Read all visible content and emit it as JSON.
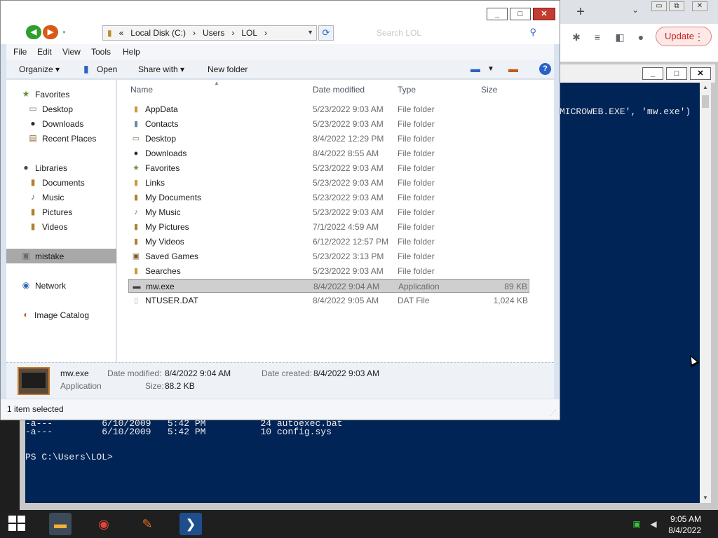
{
  "chrome": {
    "new_tab_glyph": "+",
    "tab_search_glyph": "⌄",
    "win_min": "▭",
    "win_restore": "⧉",
    "win_close": "✕",
    "update_label": "Update",
    "menu_glyph": "⋮",
    "icons": [
      "puzzle-icon",
      "media-icon",
      "sidepanel-icon",
      "profile-icon"
    ]
  },
  "powershell": {
    "win_min": "_",
    "win_max": "□",
    "win_close": "✕",
    "lines": [
      "MICROWEB.EXE', 'mw.exe')",
      "-a---         6/10/2009   5:42 PM          24 autoexec.bat",
      "-a---         6/10/2009   5:42 PM          10 config.sys",
      "PS C:\\Users\\LOL>"
    ]
  },
  "explorer": {
    "win_min": "_",
    "win_max": "□",
    "win_close": "✕",
    "nav_back": "◀",
    "nav_forward": "▶",
    "address": [
      "«",
      "Local Disk (C:)",
      "›",
      "Users",
      "›",
      "LOL",
      "›"
    ],
    "search_placeholder": "Search LOL",
    "menu": [
      "File",
      "Edit",
      "View",
      "Tools",
      "Help"
    ],
    "commands": {
      "organize": "Organize ▾",
      "open": "Open",
      "share": "Share with ▾",
      "new_folder": "New folder"
    },
    "nav": {
      "favorites": "Favorites",
      "desktop": "Desktop",
      "downloads": "Downloads",
      "recent": "Recent Places",
      "libraries": "Libraries",
      "documents": "Documents",
      "music": "Music",
      "pictures": "Pictures",
      "videos": "Videos",
      "user": "mistake",
      "network": "Network",
      "catalog": "Image Catalog"
    },
    "columns": {
      "name": "Name",
      "date": "Date modified",
      "type": "Type",
      "size": "Size"
    },
    "files": [
      {
        "name": "AppData",
        "date": "5/23/2022 9:03 AM",
        "type": "File folder",
        "size": ""
      },
      {
        "name": "Contacts",
        "date": "5/23/2022 9:03 AM",
        "type": "File folder",
        "size": ""
      },
      {
        "name": "Desktop",
        "date": "8/4/2022 12:29 PM",
        "type": "File folder",
        "size": ""
      },
      {
        "name": "Downloads",
        "date": "8/4/2022 8:55 AM",
        "type": "File folder",
        "size": ""
      },
      {
        "name": "Favorites",
        "date": "5/23/2022 9:03 AM",
        "type": "File folder",
        "size": ""
      },
      {
        "name": "Links",
        "date": "5/23/2022 9:03 AM",
        "type": "File folder",
        "size": ""
      },
      {
        "name": "My Documents",
        "date": "5/23/2022 9:03 AM",
        "type": "File folder",
        "size": ""
      },
      {
        "name": "My Music",
        "date": "5/23/2022 9:03 AM",
        "type": "File folder",
        "size": ""
      },
      {
        "name": "My Pictures",
        "date": "7/1/2022 4:59 AM",
        "type": "File folder",
        "size": ""
      },
      {
        "name": "My Videos",
        "date": "6/12/2022 12:57 PM",
        "type": "File folder",
        "size": ""
      },
      {
        "name": "Saved Games",
        "date": "5/23/2022 3:13 PM",
        "type": "File folder",
        "size": ""
      },
      {
        "name": "Searches",
        "date": "5/23/2022 9:03 AM",
        "type": "File folder",
        "size": ""
      },
      {
        "name": "mw.exe",
        "date": "8/4/2022 9:04 AM",
        "type": "Application",
        "size": "89 KB"
      },
      {
        "name": "NTUSER.DAT",
        "date": "8/4/2022 9:05 AM",
        "type": "DAT File",
        "size": "1,024 KB"
      }
    ],
    "details": {
      "name": "mw.exe",
      "kind": "Application",
      "modified_label": "Date modified:",
      "modified_value": "8/4/2022 9:04 AM",
      "created_label": "Date created:",
      "created_value": "8/4/2022 9:03 AM",
      "size_label": "Size:",
      "size_value": "88.2 KB"
    },
    "status": "1 item selected"
  },
  "taskbar": {
    "time": "9:05 AM",
    "date": "8/4/2022"
  }
}
